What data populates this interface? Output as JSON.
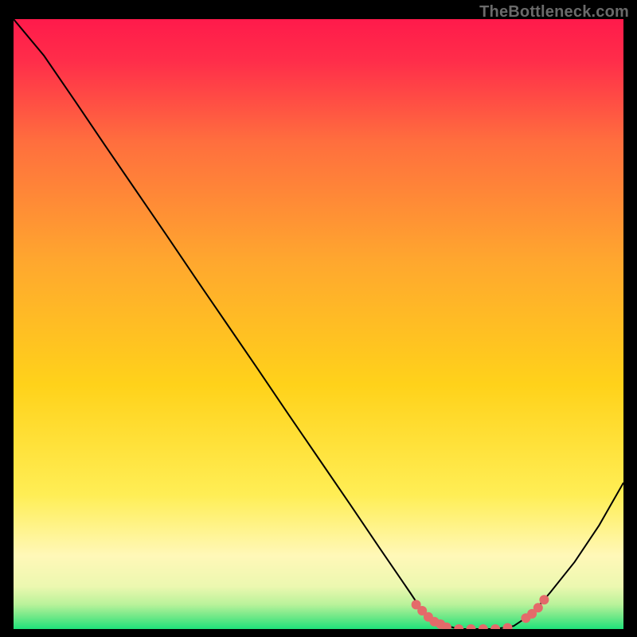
{
  "watermark": "TheBottleneck.com",
  "colors": {
    "gradient_top": "#ff1a4b",
    "gradient_mid": "#ffd21a",
    "gradient_low": "#fff8b8",
    "gradient_bottom": "#1fe27a",
    "curve": "#000000",
    "marker": "#e46a6a",
    "frame": "#000000"
  },
  "chart_data": {
    "type": "line",
    "title": "",
    "xlabel": "",
    "ylabel": "",
    "xlim": [
      0,
      100
    ],
    "ylim": [
      0,
      100
    ],
    "grid": false,
    "legend": false,
    "series": [
      {
        "name": "bottleneck-curve",
        "x": [
          0,
          5,
          10,
          15,
          20,
          25,
          30,
          35,
          40,
          45,
          50,
          55,
          60,
          65,
          67,
          70,
          73,
          76,
          79,
          82,
          85,
          88,
          92,
          96,
          100
        ],
        "y": [
          100,
          94,
          86.7,
          79.3,
          72,
          64.7,
          57.3,
          50,
          42.7,
          35.3,
          28,
          20.7,
          13.3,
          6,
          3,
          0.8,
          0,
          0,
          0,
          0.5,
          2.5,
          6,
          11,
          17,
          24
        ]
      }
    ],
    "highlight": {
      "name": "optimal-zone-markers",
      "points": [
        {
          "x": 66,
          "y": 4.0
        },
        {
          "x": 67,
          "y": 3.0
        },
        {
          "x": 68,
          "y": 2.0
        },
        {
          "x": 69,
          "y": 1.2
        },
        {
          "x": 70,
          "y": 0.8
        },
        {
          "x": 71,
          "y": 0.3
        },
        {
          "x": 73,
          "y": 0.0
        },
        {
          "x": 75,
          "y": 0.0
        },
        {
          "x": 77,
          "y": 0.0
        },
        {
          "x": 79,
          "y": 0.0
        },
        {
          "x": 81,
          "y": 0.2
        },
        {
          "x": 84,
          "y": 1.8
        },
        {
          "x": 85,
          "y": 2.5
        },
        {
          "x": 86,
          "y": 3.5
        },
        {
          "x": 87,
          "y": 4.8
        }
      ]
    }
  }
}
